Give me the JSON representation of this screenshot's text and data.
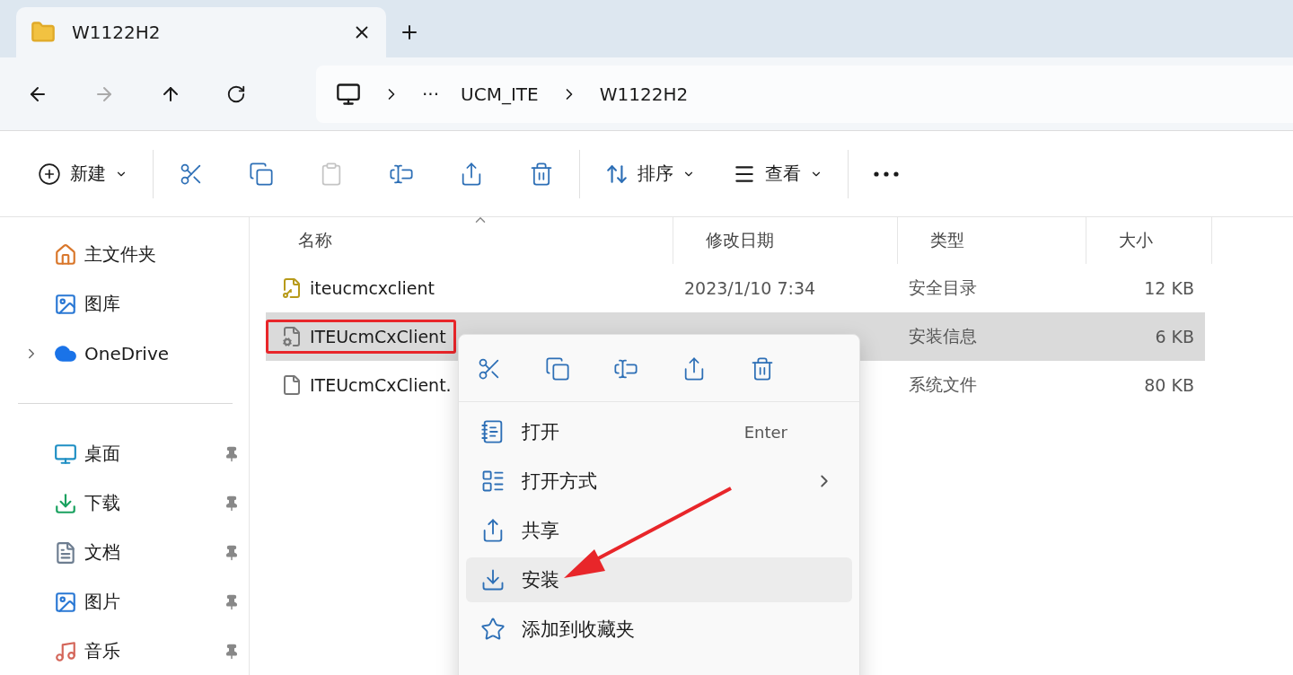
{
  "tabs": [
    {
      "label": "W1122H2",
      "selected": true
    }
  ],
  "address": {
    "crumbs": [
      "···",
      "UCM_ITE",
      "W1122H2"
    ]
  },
  "toolbar": {
    "new_label": "新建",
    "actions": [
      {
        "kind": "cut",
        "disabled": false
      },
      {
        "kind": "copy",
        "disabled": false
      },
      {
        "kind": "paste",
        "disabled": true
      },
      {
        "kind": "rename",
        "disabled": false
      },
      {
        "kind": "share",
        "disabled": false
      },
      {
        "kind": "delete",
        "disabled": false
      }
    ],
    "sort_label": "排序",
    "view_label": "查看"
  },
  "sidebar": {
    "top": [
      {
        "kind": "home",
        "label": "主文件夹",
        "expandable": false
      },
      {
        "kind": "gallery",
        "label": "图库",
        "expandable": false
      },
      {
        "kind": "cloud",
        "label": "OneDrive",
        "expandable": true
      }
    ],
    "quick": [
      {
        "kind": "desktop",
        "label": "桌面",
        "pinned": true
      },
      {
        "kind": "download",
        "label": "下载",
        "pinned": true
      },
      {
        "kind": "documents",
        "label": "文档",
        "pinned": true
      },
      {
        "kind": "pictures",
        "label": "图片",
        "pinned": true
      },
      {
        "kind": "music",
        "label": "音乐",
        "pinned": true
      }
    ]
  },
  "table": {
    "columns": [
      "名称",
      "修改日期",
      "类型",
      "大小"
    ],
    "rows": [
      {
        "kind": "catalog",
        "name": "iteucmcxclient",
        "date": "2023/1/10 7:34",
        "type": "安全目录",
        "size": "12 KB",
        "selected": false,
        "annotated": false
      },
      {
        "kind": "inf",
        "name": "ITEUcmCxClient",
        "type": "安装信息",
        "size": "6 KB",
        "selected": true,
        "annotated": true
      },
      {
        "kind": "sys",
        "name": "ITEUcmCxClient.",
        "type": "系统文件",
        "size": "80 KB",
        "selected": false,
        "annotated": false
      }
    ]
  },
  "context_menu": {
    "quick_actions": [
      {
        "kind": "cut"
      },
      {
        "kind": "copy"
      },
      {
        "kind": "rename"
      },
      {
        "kind": "share"
      },
      {
        "kind": "delete"
      }
    ],
    "items": [
      {
        "kind": "open",
        "label": "打开",
        "shortcut": "Enter",
        "submenu": false,
        "hovered": false,
        "annotated": false
      },
      {
        "kind": "open_with",
        "label": "打开方式",
        "submenu": true,
        "hovered": false,
        "annotated": false
      },
      {
        "kind": "share",
        "label": "共享",
        "submenu": false,
        "hovered": false,
        "annotated": false
      },
      {
        "kind": "install",
        "label": "安装",
        "submenu": false,
        "hovered": true,
        "annotated": true
      },
      {
        "kind": "favorite",
        "label": "添加到收藏夹",
        "submenu": false,
        "hovered": false,
        "annotated": false
      }
    ]
  }
}
